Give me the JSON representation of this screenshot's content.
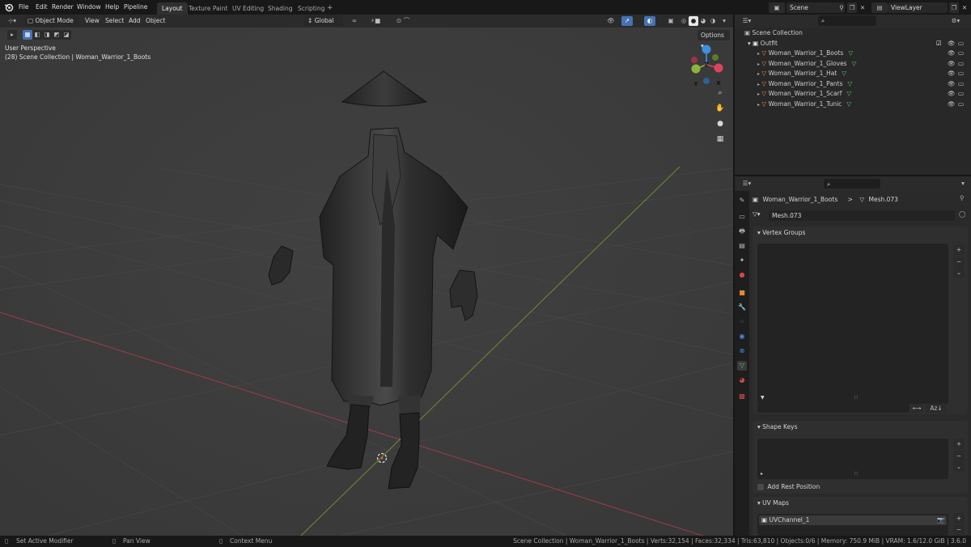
{
  "topbar": {
    "menus": [
      "File",
      "Edit",
      "Render",
      "Window",
      "Help",
      "Pipeline"
    ],
    "workspaces": [
      "Layout",
      "Texture Paint",
      "UV Editing",
      "Shading",
      "Scripting",
      "+"
    ],
    "active_workspace": "Layout",
    "scene": "Scene",
    "view_layer": "ViewLayer"
  },
  "viewport": {
    "mode": "Object Mode",
    "menus": [
      "View",
      "Select",
      "Add",
      "Object"
    ],
    "orientation": "Global",
    "options": "Options",
    "overlay_title": "User Perspective",
    "overlay_subtitle": "(28) Scene Collection | Woman_Warrior_1_Boots",
    "gizmo_axes": {
      "x": "X",
      "y": "Y",
      "z": "Z"
    }
  },
  "outliner": {
    "root": "Scene Collection",
    "collection": "Outfit",
    "items": [
      {
        "label": "Woman_Warrior_1_Boots"
      },
      {
        "label": "Woman_Warrior_1_Gloves"
      },
      {
        "label": "Woman_Warrior_1_Hat"
      },
      {
        "label": "Woman_Warrior_1_Pants"
      },
      {
        "label": "Woman_Warrior_1_Scarf"
      },
      {
        "label": "Woman_Warrior_1_Tunic"
      }
    ]
  },
  "properties": {
    "breadcrumb_object": "Woman_Warrior_1_Boots",
    "breadcrumb_sep": ">",
    "breadcrumb_mesh": "Mesh.073",
    "mesh_name": "Mesh.073",
    "vertex_groups_title": "Vertex Groups",
    "shape_keys_title": "Shape Keys",
    "add_rest_position": "Add Rest Position",
    "uv_maps_title": "UV Maps",
    "uv_channel": "UVChannel_1"
  },
  "status": {
    "left": [
      {
        "label": "Set Active Modifier"
      },
      {
        "label": "Pan View"
      },
      {
        "label": "Context Menu"
      }
    ],
    "stats": "Scene Collection | Woman_Warrior_1_Boots | Verts:32,154 | Faces:32,334 | Tris:63,810 | Objects:0/6 | Memory: 750.9 MiB | VRAM: 1.6/12.0 GiB | 3.6.0"
  },
  "colors": {
    "viewport_bg": "#3d3d3d",
    "accent_blue": "#4772b3",
    "x_axis": "#d9455d",
    "y_axis": "#8bb53a",
    "z_axis": "#3d8fe0",
    "mesh_icon": "#58c472",
    "object_icon": "#e08a3c"
  }
}
